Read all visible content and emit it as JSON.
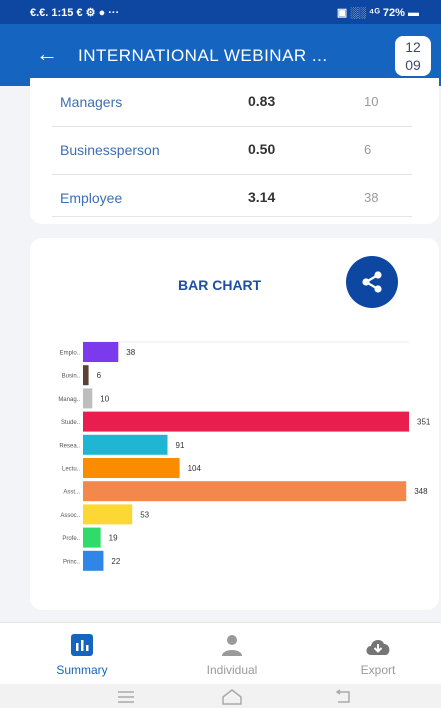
{
  "status_bar": {
    "left": "€.€. 1:15 € ⚙ ● ···",
    "right": "▣ ░░ ⁴ᴳ 72% ▬"
  },
  "app_bar": {
    "back_icon": "arrow-left",
    "title": "INTERNATIONAL WEBINAR ...",
    "date_top": "12",
    "date_bottom": "09"
  },
  "summary_rows": [
    {
      "label": "Managers",
      "value": "0.83",
      "count": "10"
    },
    {
      "label": "Businessperson",
      "value": "0.50",
      "count": "6"
    },
    {
      "label": "Employee",
      "value": "3.14",
      "count": "38"
    }
  ],
  "chart_card": {
    "title": "BAR CHART",
    "share_icon": "share"
  },
  "chart_data": {
    "type": "bar",
    "orientation": "horizontal",
    "categories": [
      "Emplo..",
      "Busin..",
      "Manag..",
      "Stude..",
      "Resea..",
      "Lectu..",
      "Asst...",
      "Assoc..",
      "Profe..",
      "Princ.."
    ],
    "values": [
      38,
      6,
      10,
      351,
      91,
      104,
      348,
      53,
      19,
      22
    ],
    "colors": [
      "#7c3aed",
      "#5d4037",
      "#bdbdbd",
      "#e91e4f",
      "#1fb6d3",
      "#fb8c00",
      "#f4874b",
      "#fdd835",
      "#2fdc6a",
      "#2f86e6"
    ],
    "xlim": [
      0,
      351
    ]
  },
  "bottom_nav": {
    "items": [
      {
        "label": "Summary",
        "icon": "bar-chart"
      },
      {
        "label": "Individual",
        "icon": "person"
      },
      {
        "label": "Export",
        "icon": "cloud-download"
      }
    ],
    "active_color": "#1565c0",
    "inactive_color": "#9a9a9a"
  },
  "system_nav": {
    "menu_icon": "menu-lines",
    "home_icon": "home-outline",
    "back_icon": "back-return"
  }
}
